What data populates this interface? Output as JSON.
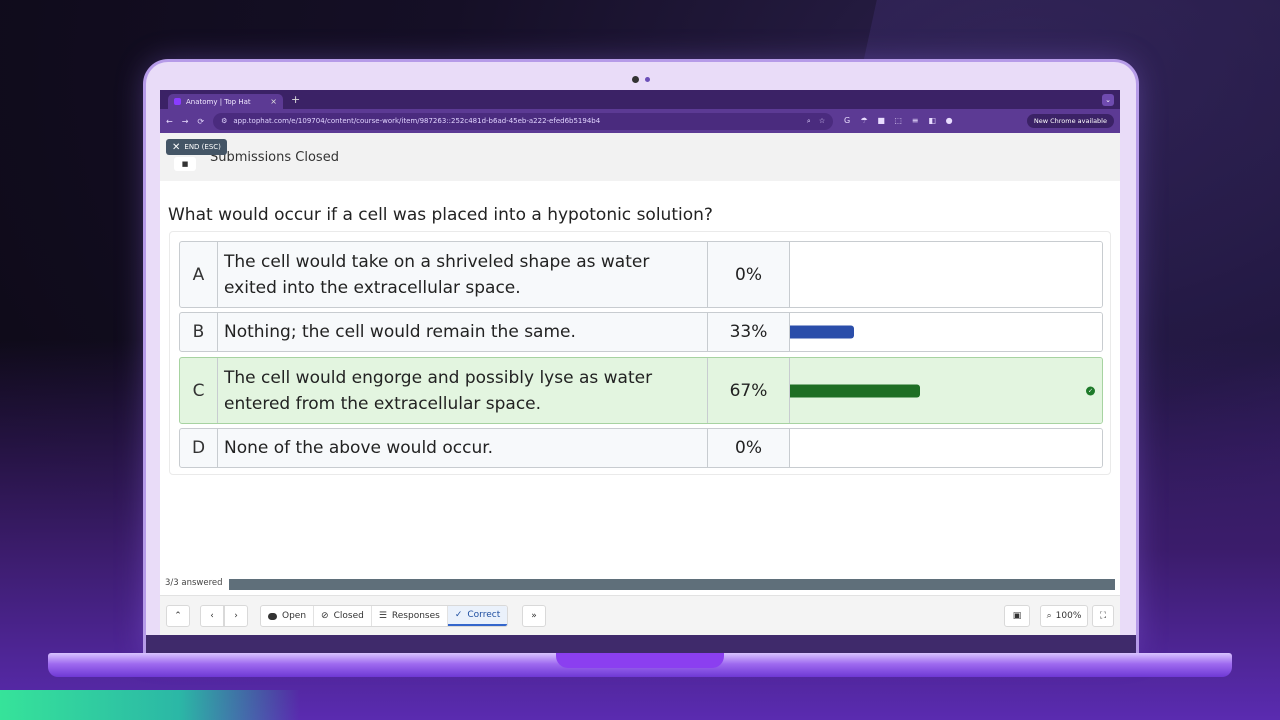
{
  "browser": {
    "tab_title": "Anatomy | Top Hat",
    "tab_close": "×",
    "new_tab": "+",
    "url": "app.tophat.com/e/109704/content/course-work/item/987263::252c481d-b6ad-45eb-a222-efed6b5194b4",
    "new_chrome_label": "New Chrome available",
    "nav_back": "←",
    "nav_forward": "→",
    "nav_reload": "⟳",
    "site_info": "⚙",
    "zoom_icon": "⌕",
    "star_icon": "☆",
    "ext_icons": [
      "G",
      "☂",
      "■",
      "⬚",
      "≡",
      "◧",
      "●"
    ],
    "tab_chevron": "⌄"
  },
  "header": {
    "end_button_label": "END (ESC)",
    "status_text": "Submissions Closed"
  },
  "question": {
    "text": "What would occur if a cell was placed into a hypotonic solution?"
  },
  "answers": [
    {
      "letter": "A",
      "text": "The cell would take on a shriveled shape as water exited into the extracellular space.",
      "percent_label": "0%",
      "percent": 0,
      "correct": false,
      "bar_color": "#2b4eaa"
    },
    {
      "letter": "B",
      "text": "Nothing; the cell would remain the same.",
      "percent_label": "33%",
      "percent": 33,
      "correct": false,
      "bar_color": "#2b4eaa"
    },
    {
      "letter": "C",
      "text": "The cell would engorge and possibly lyse as water entered from the extracellular space.",
      "percent_label": "67%",
      "percent": 67,
      "correct": true,
      "bar_color": "#1e6e24"
    },
    {
      "letter": "D",
      "text": "None of the above would occur.",
      "percent_label": "0%",
      "percent": 0,
      "correct": false,
      "bar_color": "#2b4eaa"
    }
  ],
  "progress": {
    "label": "3/3 answered",
    "fraction": 1.0
  },
  "toolbar": {
    "collapse_icon": "chevron-up-icon",
    "prev_icon": "chevron-left-icon",
    "next_icon": "chevron-right-icon",
    "open_label": "Open",
    "closed_label": "Closed",
    "responses_label": "Responses",
    "correct_label": "Correct",
    "more_icon": "double-chevron-right-icon",
    "zoom_label": "100%"
  }
}
